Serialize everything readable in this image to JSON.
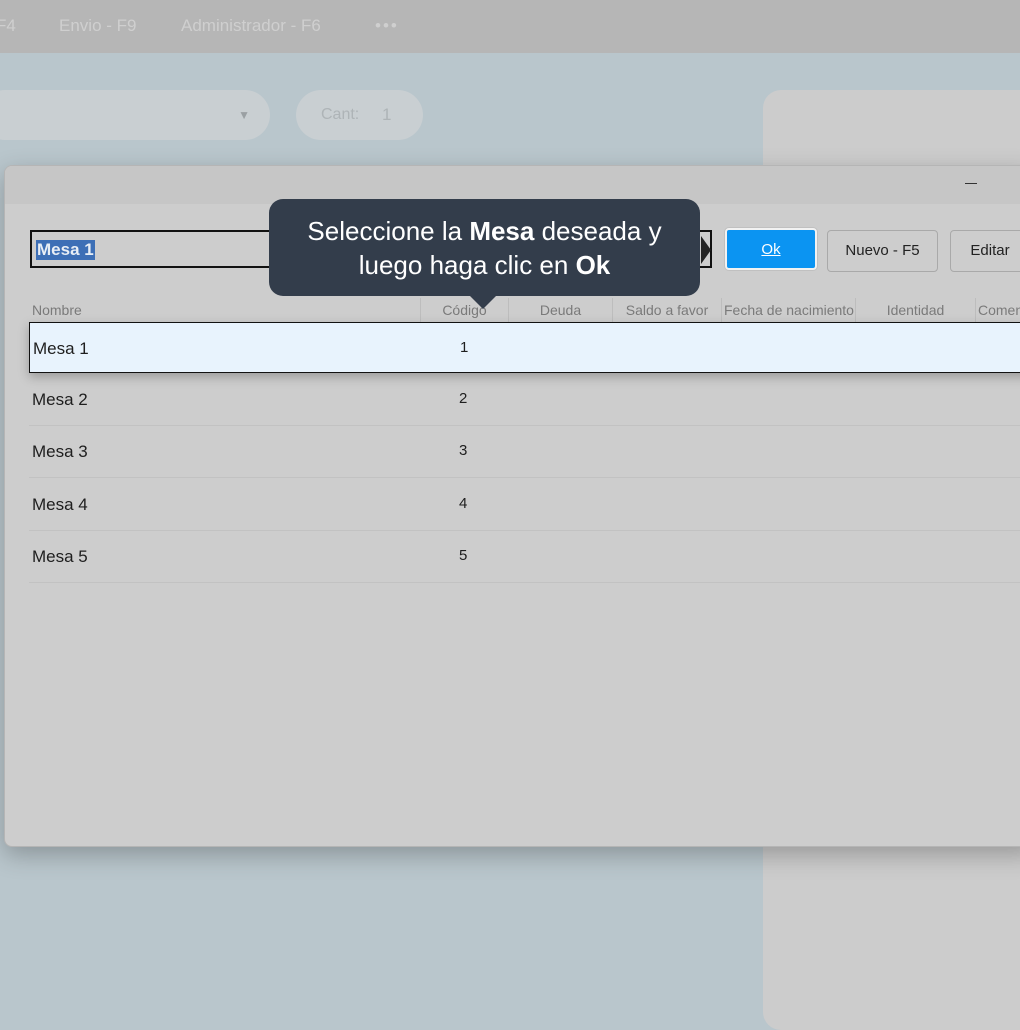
{
  "topbar": {
    "items": [
      "F4",
      "Envio - F9",
      "Administrador - F6",
      "•••"
    ]
  },
  "background": {
    "qty_label": "Cant:",
    "qty_value": "1"
  },
  "dialog": {
    "search_value": "Mesa 1",
    "buttons": {
      "ok": "Ok",
      "new": "Nuevo - F5",
      "edit": "Editar"
    },
    "columns": [
      "Nombre",
      "Código",
      "Deuda",
      "Saldo a favor",
      "Fecha de nacimiento",
      "Identidad",
      "Comentario"
    ],
    "rows": [
      {
        "name": "Mesa 1",
        "code": "1",
        "selected": true
      },
      {
        "name": "Mesa 2",
        "code": "2"
      },
      {
        "name": "Mesa 3",
        "code": "3"
      },
      {
        "name": "Mesa 4",
        "code": "4"
      },
      {
        "name": "Mesa 5",
        "code": "5"
      }
    ]
  },
  "tooltip": {
    "line1_pre": "Seleccione la ",
    "line1_bold": "Mesa",
    "line1_post": " deseada y",
    "line2_pre": "luego haga clic en ",
    "line2_bold": "Ok"
  },
  "colors": {
    "accent": "#0b94f2",
    "tooltip_bg": "#333d4b",
    "selection_bg": "#e8f3fd"
  }
}
